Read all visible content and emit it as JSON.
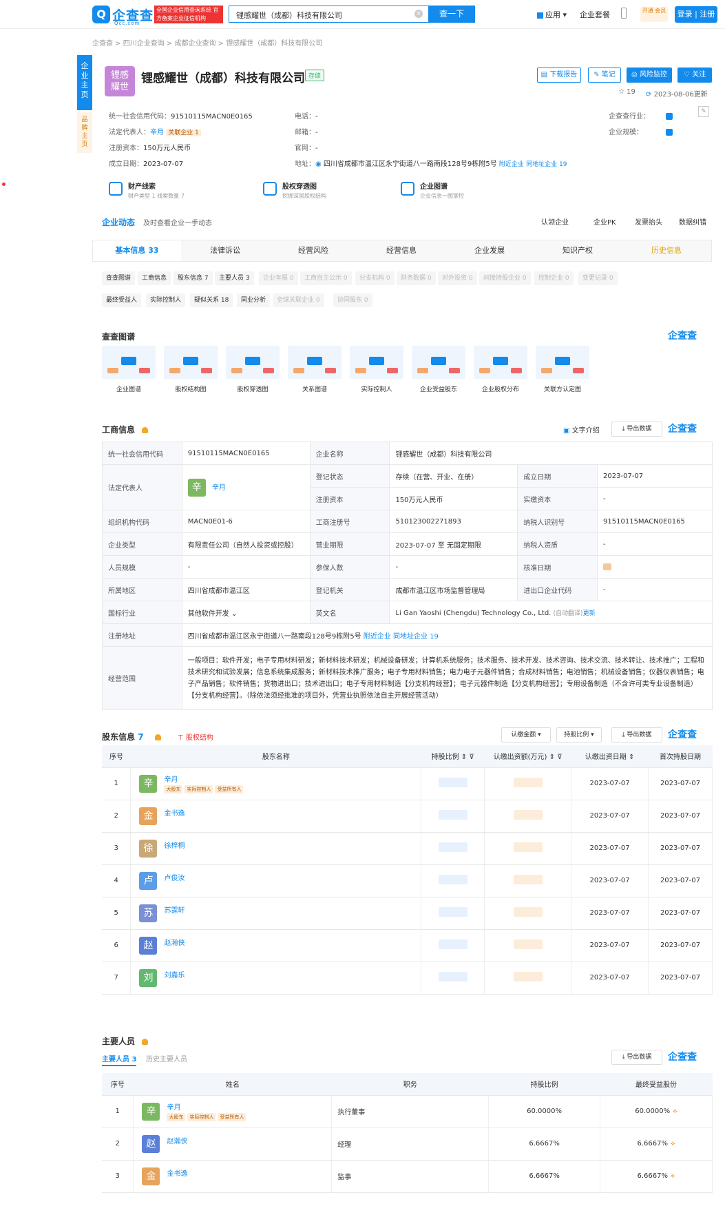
{
  "header": {
    "logo_text": "企查查",
    "logo_sub": "Qcc.com",
    "logo_tag": "全国企业信用查询系统 官方备案企业征信机构",
    "search_value": "锂感耀世（成都）科技有限公司",
    "search_button": "查一下",
    "nav": {
      "apps": "应用",
      "package": "企业套餐",
      "vip": "开通 会员",
      "login": "登录 | 注册"
    }
  },
  "breadcrumb": "企查查 > 四川企业查询 > 成都企业查询 > 锂感耀世（成都）科技有限公司",
  "left_strip": {
    "main": "企业主页",
    "brand": "品牌主页"
  },
  "company": {
    "logo_text": "锂感耀世",
    "name": "锂感耀世（成都）科技有限公司",
    "status": "存续",
    "buttons": {
      "download": "下载报告",
      "notes": "笔记",
      "monitor": "风险监控",
      "follow": "关注"
    },
    "views": "19",
    "updated": "2023-08-06更新",
    "credit_code_label": "统一社会信用代码：",
    "credit_code": "91510115MACN0E0165",
    "legal_label": "法定代表人：",
    "legal": "辛月",
    "related": "关联企业 1",
    "capital_label": "注册资本：",
    "capital": "150万元人民币",
    "founded_label": "成立日期：",
    "founded": "2023-07-07",
    "phone_label": "电话：",
    "phone": "-",
    "email_label": "邮箱：",
    "email": "-",
    "website_label": "官网：",
    "website": "-",
    "address_label": "地址：",
    "address": "四川省成都市温江区永宁街道八一路南段128号9栋附5号",
    "nearby": "附近企业",
    "same_address": "同地址企业 19",
    "industry_label": "企查查行业：",
    "scale_label": "企业规模："
  },
  "quick": [
    {
      "title": "财产线索",
      "sub": "财产类型 1  线索数量 7"
    },
    {
      "title": "股权穿透图",
      "sub": "挖掘深层股权结构"
    },
    {
      "title": "企业图谱",
      "sub": "企业信息一图掌控"
    }
  ],
  "dynamics": {
    "title": "企业动态",
    "sub": "及时查看企业一手动态",
    "actions": [
      "认领企业",
      "企业PK",
      "发票抬头",
      "数据纠错"
    ]
  },
  "tabs": [
    "基本信息 33",
    "法律诉讼",
    "经营风险",
    "经营信息",
    "企业发展",
    "知识产权",
    "历史信息"
  ],
  "chips_row1": [
    "查查图谱",
    "工商信息",
    "股东信息 7",
    "主要人员 3",
    "企业年报 0",
    "工商自主公示 0",
    "分支机构 0",
    "财务数据 0",
    "对外投资 0",
    "间接持股企业 0",
    "控制企业 0",
    "变更记录 0"
  ],
  "chips_row2": [
    "最终受益人",
    "实际控制人",
    "疑似关系 18",
    "同业分析",
    "全球关联企业 0",
    "协同股东 0"
  ],
  "graphs": {
    "title": "查查图谱",
    "brand": "企查查",
    "items": [
      "企业图谱",
      "股权结构图",
      "股权穿透图",
      "关系图谱",
      "实际控制人",
      "企业受益股东",
      "企业股权分布",
      "关联方认定图"
    ]
  },
  "business": {
    "title": "工商信息",
    "text_intro": "文字介绍",
    "export": "导出数据",
    "rows": {
      "credit_code_k": "统一社会信用代码",
      "credit_code_v": "91510115MACN0E0165",
      "name_k": "企业名称",
      "name_v": "锂感耀世（成都）科技有限公司",
      "legal_k": "法定代表人",
      "legal_v": "辛月",
      "legal_avatar": "辛",
      "reg_status_k": "登记状态",
      "reg_status_v": "存续（在营、开业、在册）",
      "founded_k": "成立日期",
      "founded_v": "2023-07-07",
      "capital_k": "注册资本",
      "capital_v": "150万元人民币",
      "paid_k": "实缴资本",
      "paid_v": "-",
      "org_k": "组织机构代码",
      "org_v": "MACN0E01-6",
      "regno_k": "工商注册号",
      "regno_v": "510123002271893",
      "taxid_k": "纳税人识别号",
      "taxid_v": "91510115MACN0E0165",
      "type_k": "企业类型",
      "type_v": "有限责任公司（自然人投资或控股）",
      "term_k": "营业期限",
      "term_v": "2023-07-07 至 无固定期限",
      "taxq_k": "纳税人资质",
      "taxq_v": "-",
      "staff_k": "人员规模",
      "staff_v": "-",
      "insured_k": "参保人数",
      "insured_v": "-",
      "approve_k": "核准日期",
      "region_k": "所属地区",
      "region_v": "四川省成都市温江区",
      "authority_k": "登记机关",
      "authority_v": "成都市温江区市场监督管理局",
      "impexp_k": "进出口企业代码",
      "impexp_v": "-",
      "industry_k": "国标行业",
      "industry_v": "其他软件开发",
      "en_k": "英文名",
      "en_v": "Li Gan Yaoshi (Chengdu) Technology Co., Ltd.",
      "en_note": "(自动翻译)",
      "en_update": "更新",
      "addr_k": "注册地址",
      "addr_v": "四川省成都市温江区永宁街道八一路南段128号9栋附5号",
      "addr_nearby": "附近企业",
      "addr_same": "同地址企业 19",
      "scope_k": "经营范围",
      "scope_v": "一般项目：软件开发；电子专用材料研发；新材料技术研发；机械设备研发；计算机系统服务；技术服务、技术开发、技术咨询、技术交流、技术转让、技术推广；工程和技术研究和试验发展；信息系统集成服务；新材料技术推广服务；电子专用材料销售；电力电子元器件销售；合成材料销售；电池销售；机械设备销售；仪器仪表销售；电子产品销售；软件销售；货物进出口；技术进出口；电子专用材料制造【分支机构经营】；电子元器件制造【分支机构经营】；专用设备制造（不含许可类专业设备制造）【分支机构经营】。（除依法须经批准的项目外，凭营业执照依法自主开展经营活动）"
    }
  },
  "shareholders": {
    "title": "股东信息",
    "count": "7",
    "equity_link": "股权结构",
    "btn_amount": "认缴金额",
    "btn_ratio": "持股比例",
    "export": "导出数据",
    "headers": [
      "序号",
      "股东名称",
      "持股比例",
      "认缴出资额(万元)",
      "认缴出资日期",
      "首次持股日期"
    ],
    "rows": [
      {
        "no": "1",
        "avatar": "辛",
        "color": "#7cb862",
        "name": "辛月",
        "tags": [
          "大股东",
          "实际控制人",
          "受益所有人"
        ],
        "date1": "2023-07-07",
        "date2": "2023-07-07"
      },
      {
        "no": "2",
        "avatar": "金",
        "color": "#e7a35b",
        "name": "金书逸",
        "tags": [],
        "date1": "2023-07-07",
        "date2": "2023-07-07"
      },
      {
        "no": "3",
        "avatar": "徐",
        "color": "#c9a877",
        "name": "徐梓桐",
        "tags": [],
        "date1": "2023-07-07",
        "date2": "2023-07-07"
      },
      {
        "no": "4",
        "avatar": "卢",
        "color": "#5b9ee7",
        "name": "卢俊汝",
        "tags": [],
        "date1": "2023-07-07",
        "date2": "2023-07-07"
      },
      {
        "no": "5",
        "avatar": "苏",
        "color": "#7a8fd6",
        "name": "苏霆轩",
        "tags": [],
        "date1": "2023-07-07",
        "date2": "2023-07-07"
      },
      {
        "no": "6",
        "avatar": "赵",
        "color": "#5b7fd6",
        "name": "赵瀚侠",
        "tags": [],
        "date1": "2023-07-07",
        "date2": "2023-07-07"
      },
      {
        "no": "7",
        "avatar": "刘",
        "color": "#62b86f",
        "name": "刘嘉乐",
        "tags": [],
        "date1": "2023-07-07",
        "date2": "2023-07-07"
      }
    ]
  },
  "managers": {
    "title": "主要人员",
    "tab_current": "主要人员 3",
    "tab_history": "历史主要人员",
    "export": "导出数据",
    "headers": [
      "序号",
      "姓名",
      "职务",
      "持股比例",
      "最终受益股份"
    ],
    "rows": [
      {
        "no": "1",
        "avatar": "辛",
        "color": "#7cb862",
        "name": "辛月",
        "tags": [
          "大股东",
          "实际控制人",
          "受益所有人"
        ],
        "role": "执行董事",
        "ratio": "60.0000%",
        "benefit": "60.0000%"
      },
      {
        "no": "2",
        "avatar": "赵",
        "color": "#5b7fd6",
        "name": "赵瀚侠",
        "tags": [],
        "role": "经理",
        "ratio": "6.6667%",
        "benefit": "6.6667%"
      },
      {
        "no": "3",
        "avatar": "金",
        "color": "#e7a35b",
        "name": "金书逸",
        "tags": [],
        "role": "监事",
        "ratio": "6.6667%",
        "benefit": "6.6667%"
      }
    ]
  }
}
